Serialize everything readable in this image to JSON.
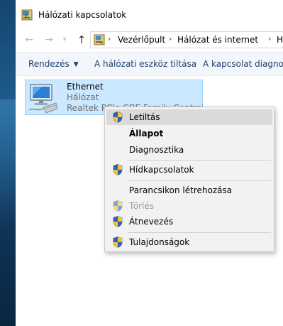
{
  "window": {
    "title": "Hálózati kapcsolatok"
  },
  "nav": {
    "breadcrumbs": [
      "Vezérlőpult",
      "Hálózat és internet",
      "Hálóz"
    ]
  },
  "toolbar": {
    "organize": "Rendezés",
    "disable": "A hálózati eszköz tiltása",
    "diagnose": "A kapcsolat diagnoszt"
  },
  "connection": {
    "name": "Ethernet",
    "status": "Hálózat",
    "adapter": "Realtek PCIe GBE Family Controller"
  },
  "context_menu": {
    "items": [
      {
        "label": "Letiltás",
        "shield": true
      },
      {
        "label": "Állapot",
        "shield": false
      },
      {
        "label": "Diagnosztika",
        "shield": false
      },
      {
        "label": "Hídkapcsolatok",
        "shield": true
      },
      {
        "label": "Parancsikon létrehozása",
        "shield": false
      },
      {
        "label": "Törlés",
        "shield": true
      },
      {
        "label": "Átnevezés",
        "shield": true
      },
      {
        "label": "Tulajdonságok",
        "shield": true
      }
    ]
  },
  "colors": {
    "selection": "#cce8ff",
    "toolbar_text": "#1a3e6e",
    "menu_bg": "#f2f2f2"
  }
}
